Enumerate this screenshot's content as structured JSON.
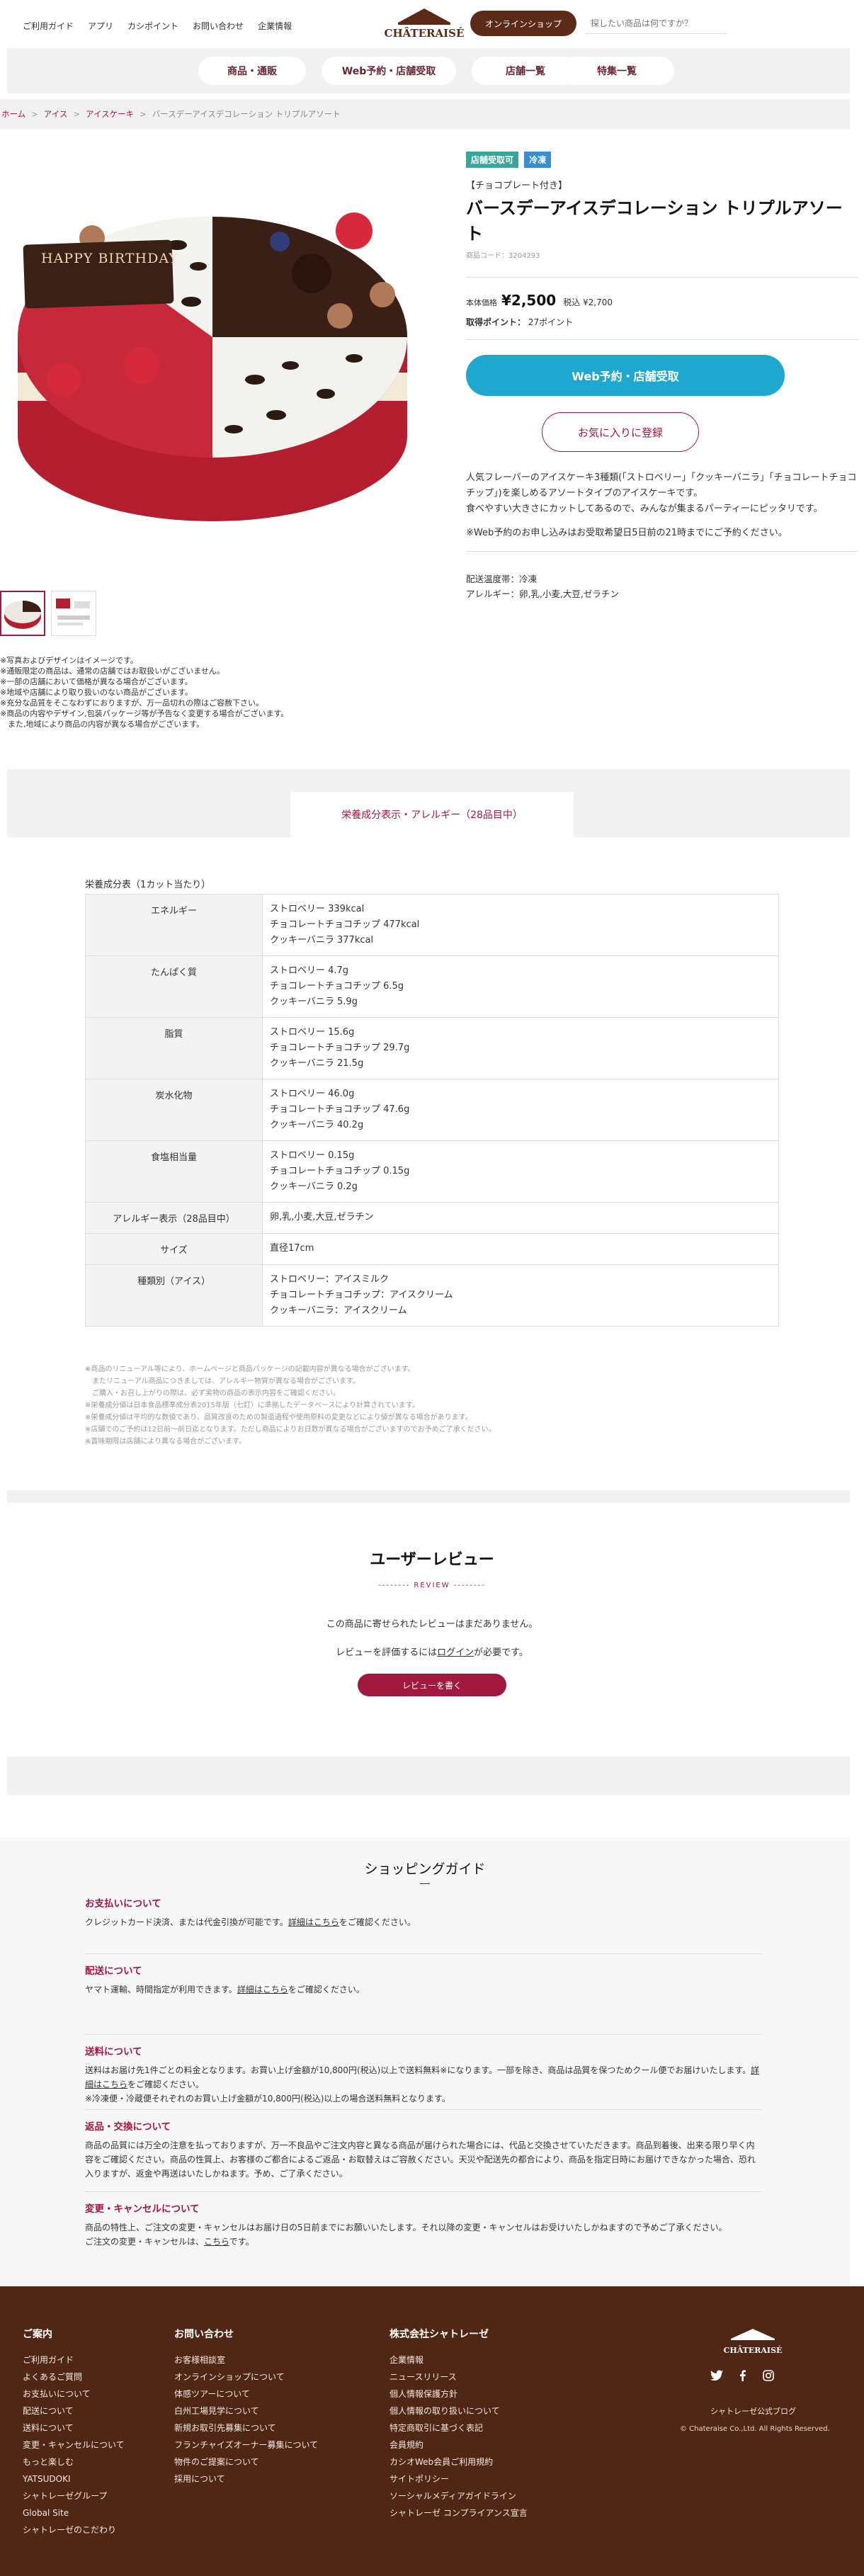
{
  "header": {
    "nav": [
      "ご利用ガイド",
      "アプリ",
      "カシポイント",
      "お問い合わせ",
      "企業情報"
    ],
    "logo_text": "CHÂTERAISÉ",
    "shop_button": "オンラインショップ",
    "search_placeholder": "探したい商品は何ですか？",
    "categories": [
      "商品・通販",
      "Web予約・店舗受取",
      "店舗一覧",
      "特集一覧"
    ]
  },
  "breadcrumb": [
    "ホーム",
    "アイス",
    "アイスケーキ",
    "バースデーアイスデコレーション トリプルアソート"
  ],
  "product": {
    "badges": [
      {
        "label": "店舗受取可",
        "color": "#3aa59a"
      },
      {
        "label": "冷凍",
        "color": "#3b8fd0"
      }
    ],
    "subtitle": "【チョコプレート付き】",
    "name": "バースデーアイスデコレーション トリプルアソート",
    "code": "商品コード：3204293",
    "price_label": "本体価格",
    "price": "¥2,500",
    "price_tax": "税込 ¥2,700",
    "points_label": "取得ポイント：",
    "points": "27ポイント",
    "web_button": "Web予約・店舗受取",
    "fav_button": "お気に入りに登録",
    "description": [
      "人気フレーバーのアイスケーキ3種類(「ストロベリー」「クッキーバニラ」「チョコレートチョコチップ」)を楽しめるアソートタイプのアイスケーキです。",
      "食べやすい大きさにカットしてあるので、みんなが集まるパーティーにピッタリです。",
      "※Web予約のお申し込みはお受取希望日5日前の21時までにご予約ください。"
    ],
    "storage": "配送温度帯：冷凍",
    "allergy": "アレルギー：卵,乳,小麦,大豆,ゼラチン",
    "plate_text": "HAPPY BIRTHDAY",
    "image_notes": [
      "※写真およびデザインはイメージです。",
      "※通販限定の商品は、通常の店舗ではお取扱いがございません。",
      "※一部の店舗において価格が異なる場合がございます。",
      "※地域や店舗により取り扱いのない商品がございます。",
      "※充分な品質をそこなわずにおりますが、万一品切れの際はご容赦下さい。",
      "※商品の内容やデザイン,包装パッケージ等が予告なく変更する場合がございます。",
      "　また,地域により商品の内容が異なる場合がございます。"
    ]
  },
  "nutrition": {
    "tab": "栄養成分表示・アレルギー（28品目中）",
    "title": "栄養成分表（1カット当たり）",
    "rows": [
      {
        "k": "エネルギー",
        "v": [
          "ストロベリー 339kcal",
          "チョコレートチョコチップ 477kcal",
          "クッキーバニラ 377kcal"
        ]
      },
      {
        "k": "たんぱく質",
        "v": [
          "ストロベリー 4.7g",
          "チョコレートチョコチップ 6.5g",
          "クッキーバニラ 5.9g"
        ]
      },
      {
        "k": "脂質",
        "v": [
          "ストロベリー 15.6g",
          "チョコレートチョコチップ 29.7g",
          "クッキーバニラ 21.5g"
        ]
      },
      {
        "k": "炭水化物",
        "v": [
          "ストロベリー 46.0g",
          "チョコレートチョコチップ 47.6g",
          "クッキーバニラ 40.2g"
        ]
      },
      {
        "k": "食塩相当量",
        "v": [
          "ストロベリー 0.15g",
          "チョコレートチョコチップ 0.15g",
          "クッキーバニラ 0.2g"
        ]
      },
      {
        "k": "アレルギー表示（28品目中）",
        "v": [
          "卵,乳,小麦,大豆,ゼラチン"
        ]
      },
      {
        "k": "サイズ",
        "v": [
          "直径17cm"
        ]
      },
      {
        "k": "種類別（アイス）",
        "v": [
          "ストロベリー：アイスミルク",
          "チョコレートチョコチップ：アイスクリーム",
          "クッキーバニラ：アイスクリーム"
        ]
      }
    ],
    "disclaimer": [
      "※商品のリニューアル等により、ホームページと商品パッケージの記載内容が異なる場合がございます。",
      "　またリニューアル商品につきましては、アレルギー物質が異なる場合がございます。",
      "　ご購入・お召し上がりの際は、必ず実物の商品の表示内容をご確認ください。",
      "※栄養成分値は日本食品標準成分表2015年版（七訂）に準拠したデータベースにより計算されています。",
      "※栄養成分値は平均的な数値であり、品質改良のための製造過程や使用原料の変更などにより値が異なる場合があります。",
      "※店舗でのご予約は12日前～前日迄となります。ただし商品によりお日数が異なる場合がございますのでお予めご了承ください。",
      "※賞味期限は店舗により異なる場合がございます。"
    ]
  },
  "review": {
    "title": "ユーザーレビュー",
    "sub": "REVIEW",
    "none": "この商品に寄せられたレビューはまだありません。",
    "login_pre": "レビューを評価するには",
    "login_link": "ログイン",
    "login_post": "が必要です。",
    "button": "レビューを書く"
  },
  "guide": {
    "title": "ショッピングガイド",
    "items": [
      {
        "h": "お支払いについて",
        "t": [
          "クレジットカード決済、または代金引換が可能です。",
          "詳細はこちら",
          "をご確認ください。"
        ]
      },
      {
        "h": "配送について",
        "t": [
          "ヤマト運輸、時間指定が利用できます。",
          "詳細はこちら",
          "をご確認ください。"
        ]
      },
      {
        "h": "送料について",
        "t": [
          "送料はお届け先1件ごとの料金となります。お買い上げ金額が10,800円(税込)以上で送料無料※になります。一部を除き、商品は品質を保つためクール便でお届けいたします。",
          "詳細はこちら",
          "をご確認ください。"
        ],
        "t2": "※冷凍便・冷蔵便それぞれのお買い上げ金額が10,800円(税込)以上の場合送料無料となります。"
      },
      {
        "h": "返品・交換について",
        "t": [
          "商品の品質には万全の注意を払っておりますが、万一不良品やご注文内容と異なる商品が届けられた場合には、代品と交換させていただきます。商品到着後、出来る限り早く内容をご確認ください。商品の性質上、お客様のご都合によるご返品・お取替えはご容赦ください。天災や配送先の都合により、商品を指定日時にお届けできなかった場合、恐れ入りますが、返金や再送はいたしかねます。予め、ご了承ください。",
          "",
          ""
        ]
      },
      {
        "h": "変更・キャンセルについて",
        "t": [
          "商品の特性上、ご注文の変更・キャンセルはお届け日の5日前までにお願いいたします。それ以降の変更・キャンセルはお受けいたしかねますので予めご了承ください。",
          "",
          ""
        ],
        "t2a": "ご注文の変更・キャンセルは、",
        "t2b": "こちら",
        "t2c": "です。"
      }
    ]
  },
  "footer": {
    "col1": {
      "h": "ご案内",
      "items": [
        "ご利用ガイド",
        "よくあるご質問",
        "お支払いについて",
        "配送について",
        "送料について",
        "変更・キャンセルについて",
        "もっと楽しむ",
        "YATSUDOKI",
        "シャトレーゼグループ",
        "Global Site",
        "シャトレーゼのこだわり"
      ]
    },
    "col2": {
      "h": "お問い合わせ",
      "items": [
        "お客様相談室",
        "オンラインショップについて",
        "体感ツアーについて",
        "白州工場見学について",
        "新規お取引先募集について",
        "フランチャイズオーナー募集について",
        "物件のご提案について",
        "採用について"
      ]
    },
    "col3": {
      "h": "株式会社シャトレーゼ",
      "items": [
        "企業情報",
        "ニュースリリース",
        "個人情報保護方針",
        "個人情報の取り扱いについて",
        "特定商取引に基づく表記",
        "会員規約",
        "カシオWeb会員ご利用規約",
        "サイトポリシー",
        "ソーシャルメディアガイドライン",
        "シャトレーゼ コンプライアンス宣言"
      ]
    },
    "logo_text": "CHÂTERAISÉ",
    "blog": "シャトレーゼ公式ブログ",
    "copyright": "© Chateraise Co.,Ltd. All Rights Reserved."
  },
  "colors": {
    "brand": "#5b2b17",
    "accent": "#a1193f",
    "web_button": "#1fa8cf"
  }
}
